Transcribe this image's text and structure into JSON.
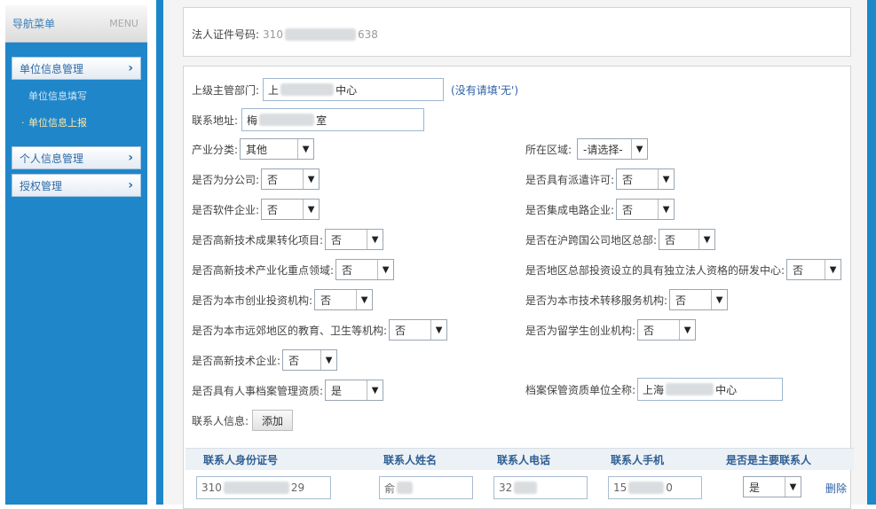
{
  "sidebar": {
    "title": "导航菜单",
    "menu_label": "MENU",
    "groups": [
      {
        "label": "单位信息管理"
      },
      {
        "label": "个人信息管理"
      },
      {
        "label": "授权管理"
      }
    ],
    "sub_items": [
      {
        "label": "单位信息填写"
      },
      {
        "label": "单位信息上报"
      }
    ]
  },
  "form": {
    "legal_id": {
      "label": "法人证件号码:",
      "value_prefix": "310",
      "value_suffix": "638"
    },
    "supervisor": {
      "label": "上级主管部门:",
      "value_prefix": "上",
      "value_suffix": "中心",
      "hint": "(没有请填'无')"
    },
    "address": {
      "label": "联系地址:",
      "value_prefix": "梅",
      "value_suffix": "室"
    },
    "industry": {
      "label": "产业分类:",
      "value": "其他"
    },
    "district": {
      "label": "所在区域:",
      "value": "-请选择-"
    },
    "branch": {
      "label": "是否为分公司:",
      "value": "否"
    },
    "dispatch": {
      "label": "是否具有派遣许可:",
      "value": "否"
    },
    "software": {
      "label": "是否软件企业:",
      "value": "否"
    },
    "ic": {
      "label": "是否集成电路企业:",
      "value": "否"
    },
    "hitech_conv": {
      "label": "是否高新技术成果转化项目:",
      "value": "否"
    },
    "multinational": {
      "label": "是否在沪跨国公司地区总部:",
      "value": "否"
    },
    "hitech_industry": {
      "label": "是否高新技术产业化重点领域:",
      "value": "否"
    },
    "rd_center": {
      "label": "是否地区总部投资设立的具有独立法人资格的研发中心:",
      "value": "否"
    },
    "venture": {
      "label": "是否为本市创业投资机构:",
      "value": "否"
    },
    "tech_transfer": {
      "label": "是否为本市技术转移服务机构:",
      "value": "否"
    },
    "edu_health": {
      "label": "是否为本市远郊地区的教育、卫生等机构:",
      "value": "否"
    },
    "returnee": {
      "label": "是否为留学生创业机构:",
      "value": "否"
    },
    "hitech": {
      "label": "是否高新技术企业:",
      "value": "否"
    },
    "hr_archive": {
      "label": "是否具有人事档案管理资质:",
      "value": "是"
    },
    "archive_unit": {
      "label": "档案保管资质单位全称:",
      "value_prefix": "上海",
      "value_suffix": "中心"
    },
    "contacts": {
      "label": "联系人信息:",
      "add_label": "添加"
    }
  },
  "contacts_table": {
    "columns": [
      "联系人身份证号",
      "联系人姓名",
      "联系人电话",
      "联系人手机",
      "是否是主要联系人"
    ],
    "rows": [
      {
        "id_prefix": "310",
        "id_suffix": "29",
        "name": "俞",
        "phone": "32",
        "mobile_prefix": "15",
        "mobile_suffix": "0",
        "primary": "是",
        "delete_label": "删除"
      }
    ]
  }
}
